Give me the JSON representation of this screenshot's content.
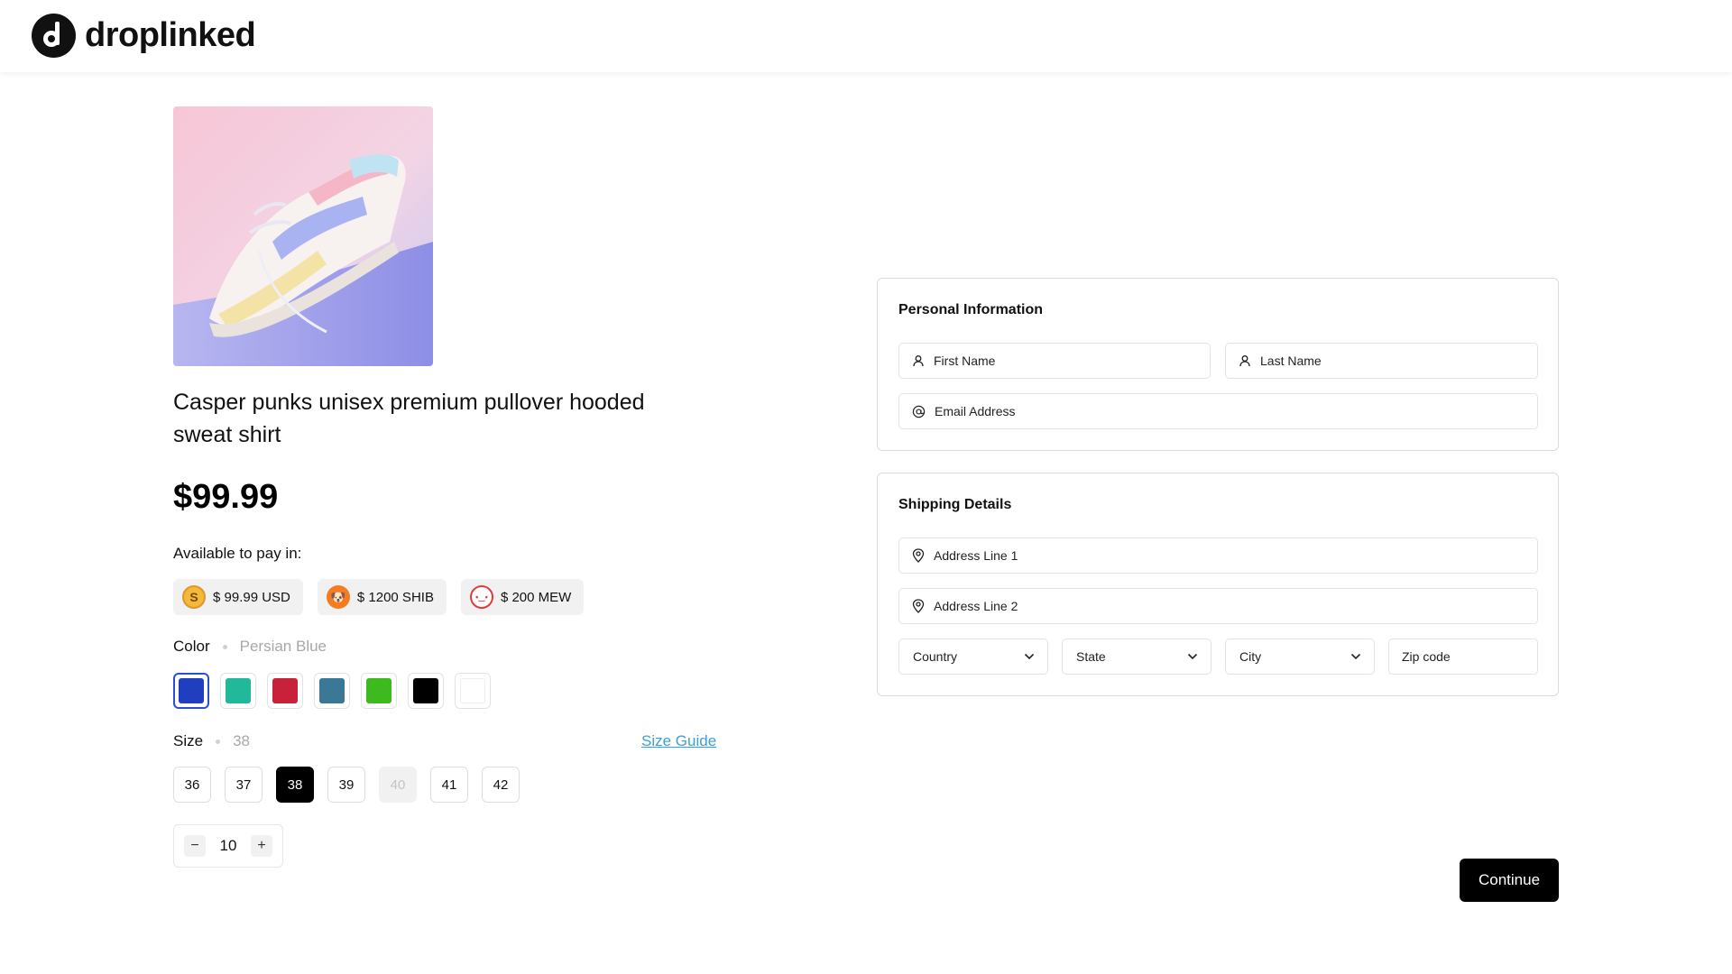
{
  "brand": {
    "name": "droplinked"
  },
  "product": {
    "title": "Casper punks unisex premium pullover hooded sweat shirt",
    "price": "$99.99",
    "pay_label": "Available to pay in:",
    "pay_options": [
      {
        "icon": "usd-coin-icon",
        "label": "$ 99.99 USD",
        "glyph": "S"
      },
      {
        "icon": "shib-token-icon",
        "label": "$ 1200 SHIB",
        "glyph": "🐶"
      },
      {
        "icon": "mew-token-icon",
        "label": "$ 200 MEW",
        "glyph": "•‿•"
      }
    ],
    "color": {
      "label": "Color",
      "selected": "Persian Blue",
      "swatches": [
        "#1f3fbf",
        "#22b89a",
        "#c8223a",
        "#3b7895",
        "#3dbb1e",
        "#000000",
        "#ffffff"
      ]
    },
    "size": {
      "label": "Size",
      "selected": "38",
      "guide_label": "Size Guide",
      "options": [
        "36",
        "37",
        "38",
        "39",
        "40",
        "41",
        "42"
      ]
    },
    "quantity": {
      "value": "10",
      "minus": "−",
      "plus": "+"
    }
  },
  "personal_info": {
    "title": "Personal Information",
    "first_name_placeholder": "First Name",
    "last_name_placeholder": "Last Name",
    "email_placeholder": "Email Address"
  },
  "shipping": {
    "title": "Shipping Details",
    "address1_placeholder": "Address Line 1",
    "address2_placeholder": "Address Line 2",
    "country_label": "Country",
    "state_label": "State",
    "city_label": "City",
    "zip_placeholder": "Zip code"
  },
  "actions": {
    "continue_label": "Continue"
  },
  "colors": {
    "accent": "#000000",
    "link": "#3aa0d8",
    "selected_swatch_border": "#2a4fd6"
  }
}
